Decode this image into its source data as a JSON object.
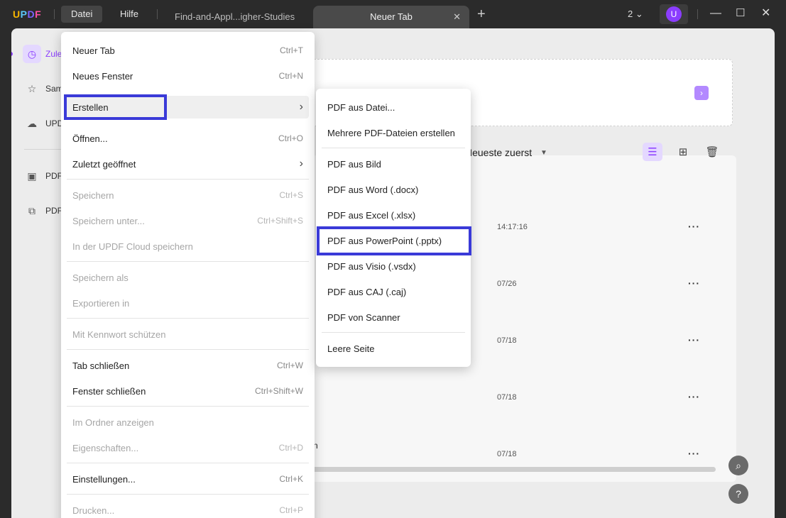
{
  "titlebar": {
    "logo": "UPDF",
    "menus": [
      "Datei",
      "Hilfe"
    ],
    "tabs": [
      {
        "label": "Find-and-Appl...igher-Studies"
      },
      {
        "label": "Neuer Tab"
      }
    ],
    "window_count": "2",
    "user_initial": "U"
  },
  "sidebar": {
    "items": [
      {
        "label": "Zule",
        "icon": "clock-icon"
      },
      {
        "label": "Sam",
        "icon": "star-icon"
      },
      {
        "label": "UPD",
        "icon": "cloud-icon"
      },
      {
        "label": "PDF",
        "icon": "briefcase-icon"
      },
      {
        "label": "PDF",
        "icon": "copy-icon"
      }
    ]
  },
  "content": {
    "sort_label": "Neueste zuerst",
    "rows": [
      {
        "time": "14:17:16"
      },
      {
        "time": "07/26"
      },
      {
        "time": "07/18"
      },
      {
        "time": "07/18"
      },
      {
        "time": "07/18"
      }
    ],
    "row_fragment": "n"
  },
  "file_menu": {
    "items": [
      {
        "label": "Neuer Tab",
        "shortcut": "Ctrl+T"
      },
      {
        "label": "Neues Fenster",
        "shortcut": "Ctrl+N"
      },
      {
        "label": "Erstellen",
        "shortcut": ""
      },
      {
        "label": "Öffnen...",
        "shortcut": "Ctrl+O"
      },
      {
        "label": "Zuletzt geöffnet",
        "shortcut": ""
      },
      {
        "label": "Speichern",
        "shortcut": "Ctrl+S"
      },
      {
        "label": "Speichern unter...",
        "shortcut": "Ctrl+Shift+S"
      },
      {
        "label": "In der UPDF Cloud speichern",
        "shortcut": ""
      },
      {
        "label": "Speichern als",
        "shortcut": ""
      },
      {
        "label": "Exportieren in",
        "shortcut": ""
      },
      {
        "label": "Mit Kennwort schützen",
        "shortcut": ""
      },
      {
        "label": "Tab schließen",
        "shortcut": "Ctrl+W"
      },
      {
        "label": "Fenster schließen",
        "shortcut": "Ctrl+Shift+W"
      },
      {
        "label": "Im Ordner anzeigen",
        "shortcut": ""
      },
      {
        "label": "Eigenschaften...",
        "shortcut": "Ctrl+D"
      },
      {
        "label": "Einstellungen...",
        "shortcut": "Ctrl+K"
      },
      {
        "label": "Drucken...",
        "shortcut": "Ctrl+P"
      }
    ]
  },
  "create_submenu": {
    "items": [
      {
        "label": "PDF aus Datei..."
      },
      {
        "label": "Mehrere PDF-Dateien erstellen"
      },
      {
        "label": "PDF aus Bild"
      },
      {
        "label": "PDF aus Word (.docx)"
      },
      {
        "label": "PDF aus Excel (.xlsx)"
      },
      {
        "label": "PDF aus PowerPoint (.pptx)"
      },
      {
        "label": "PDF aus Visio (.vsdx)"
      },
      {
        "label": "PDF aus CAJ (.caj)"
      },
      {
        "label": "PDF von Scanner"
      },
      {
        "label": "Leere Seite"
      }
    ]
  },
  "colors": {
    "accent": "#8b3dff",
    "highlight_box": "#3a3ad8",
    "titlebar_bg": "#2b2b2b"
  }
}
